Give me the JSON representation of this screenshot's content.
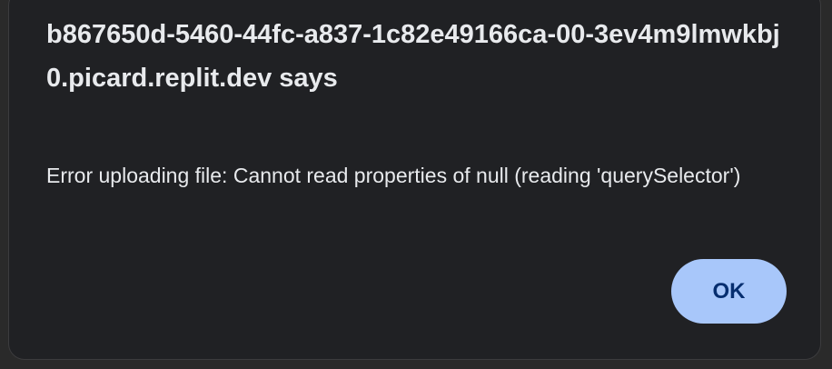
{
  "dialog": {
    "title": "b867650d-5460-44fc-a837-1c82e49166ca-00-3ev4m9lmwkbj0.picard.replit.dev says",
    "message": "Error uploading file: Cannot read properties of null (reading 'querySelector')",
    "ok_label": "OK",
    "colors": {
      "background": "#202124",
      "button": "#a8c7fa",
      "button_text": "#062e6f"
    }
  }
}
